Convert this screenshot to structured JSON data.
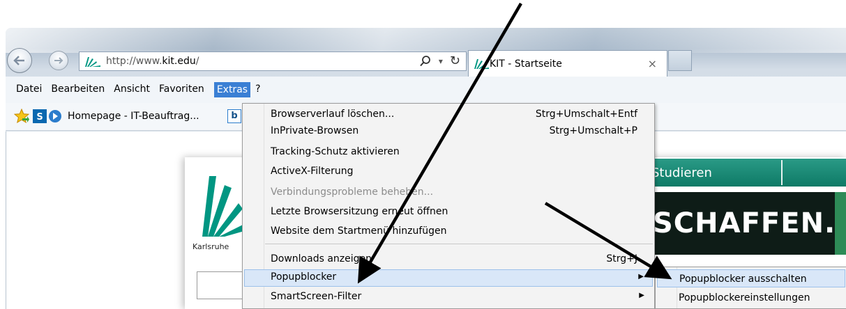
{
  "browser": {
    "address": {
      "prefix": "http://www.",
      "domain": "kit.edu",
      "suffix": "/"
    },
    "tab": {
      "title": "KIT - Startseite",
      "close_glyph": "×"
    },
    "search_glyph": "⌕",
    "dropdown_glyph": "▾",
    "refresh_glyph": "↻"
  },
  "menubar": {
    "items": [
      "Datei",
      "Bearbeiten",
      "Ansicht",
      "Favoriten",
      "Extras",
      "?"
    ],
    "active": "Extras"
  },
  "favorites": {
    "item_label": "Homepage - IT-Beauftrag...",
    "bing_label": "b"
  },
  "extras_menu": {
    "items": [
      {
        "label": "Browserverlauf löschen...",
        "shortcut": "Strg+Umschalt+Entf"
      },
      {
        "label": "InPrivate-Browsen",
        "shortcut": "Strg+Umschalt+P"
      },
      {
        "label": "Tracking-Schutz aktivieren",
        "shortcut": ""
      },
      {
        "label": "ActiveX-Filterung",
        "shortcut": ""
      },
      {
        "label": "Verbindungsprobleme beheben...",
        "shortcut": "",
        "disabled": true
      },
      {
        "label": "Letzte Browsersitzung erneut öffnen",
        "shortcut": ""
      },
      {
        "label": "Website dem Startmenü hinzufügen",
        "shortcut": ""
      },
      {
        "label": "Downloads anzeigen",
        "shortcut": "Strg+J"
      },
      {
        "label": "Popupblocker",
        "shortcut": "",
        "submenu": true,
        "highlighted": true
      },
      {
        "label": "SmartScreen-Filter",
        "shortcut": "",
        "submenu": true
      }
    ]
  },
  "popup_submenu": {
    "items": [
      {
        "label": "Popupblocker ausschalten",
        "highlighted": true
      },
      {
        "label": "Popupblockereinstellungen"
      }
    ]
  },
  "page": {
    "kit_karlsruhe": "Karlsruhe",
    "nav_band_text": "Studieren",
    "banner_text": "SCHAFFEN."
  },
  "colors": {
    "menu_active": "#3a7fd4",
    "kit_green": "#009682",
    "hover_bg": "#d9e7f8"
  }
}
